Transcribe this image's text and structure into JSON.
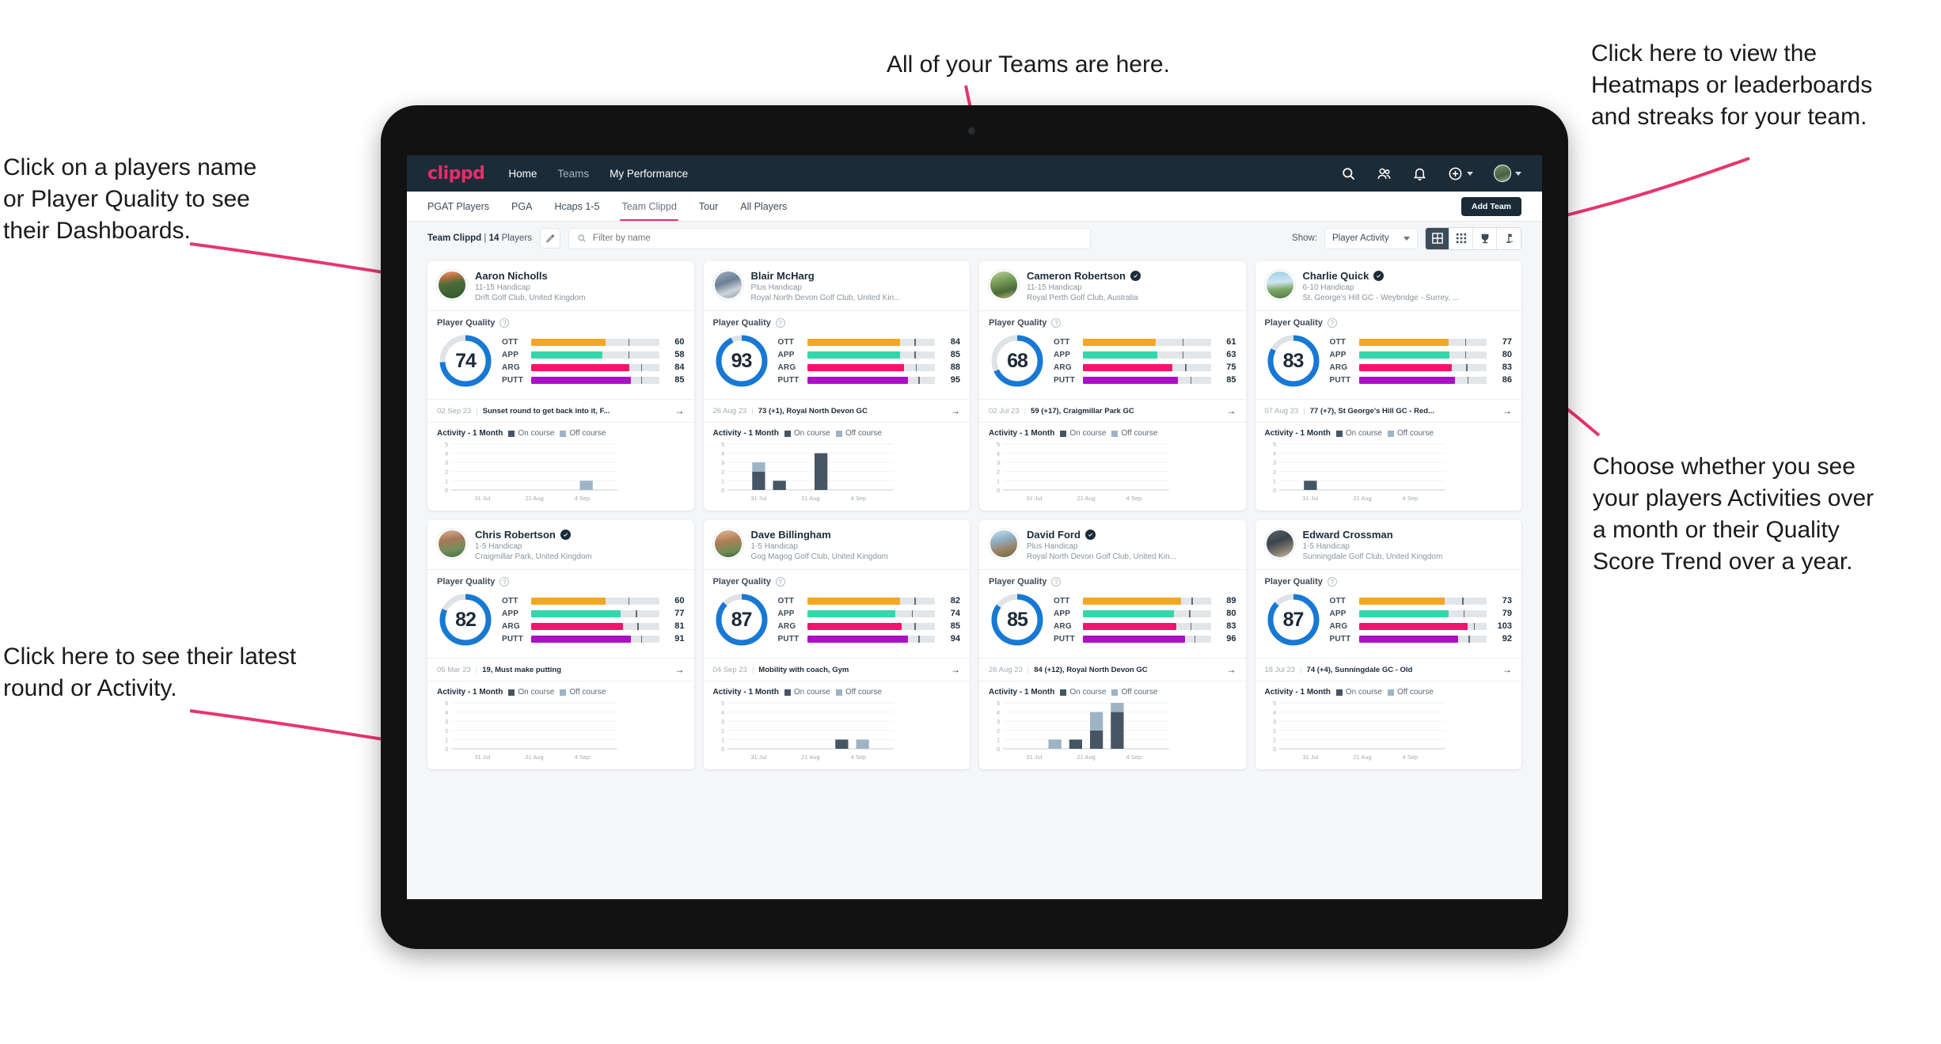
{
  "annotations": [
    {
      "id": "teams",
      "text": "All of your Teams are here."
    },
    {
      "id": "heatmaps",
      "text": "Click here to view the\nHeatmaps or leaderboards\nand streaks for your team."
    },
    {
      "id": "playername",
      "text": "Click on a players name\nor Player Quality to see\ntheir Dashboards."
    },
    {
      "id": "showmode",
      "text": "Choose whether you see\nyour players Activities over\na month or their Quality\nScore Trend over a year."
    },
    {
      "id": "latestround",
      "text": "Click here to see their latest\nround or Activity."
    }
  ],
  "app": {
    "logo": "clippd",
    "nav": [
      {
        "label": "Home",
        "active": true
      },
      {
        "label": "Teams",
        "active": false
      },
      {
        "label": "My Performance",
        "active": true
      }
    ],
    "icons": [
      "search-icon",
      "people-icon",
      "bell-icon",
      "plus-circle-icon",
      "avatar"
    ],
    "subtabs": [
      {
        "label": "PGAT Players",
        "active": false
      },
      {
        "label": "PGA",
        "active": false
      },
      {
        "label": "Hcaps 1-5",
        "active": false
      },
      {
        "label": "Team Clippd",
        "active": true
      },
      {
        "label": "Tour",
        "active": false
      },
      {
        "label": "All Players",
        "active": false
      }
    ],
    "add_team_label": "Add Team",
    "team_label_prefix": "Team Clippd",
    "team_label_sep": "|",
    "team_label_count": "14",
    "team_label_suffix": "Players",
    "search_placeholder": "Filter by name",
    "search_value": "",
    "show_label": "Show:",
    "show_value": "Player Activity",
    "show_options": [
      "Player Activity",
      "Quality Score Trend"
    ],
    "view_buttons": [
      "grid-view-icon",
      "dots-grid-icon",
      "trophy-icon",
      "flag-icon"
    ],
    "colors": {
      "brand_pink": "#ee2b6c",
      "navy": "#1c2b38",
      "ott": "#f5a623",
      "app": "#35d6ab",
      "arg": "#f5146b",
      "putt": "#aa11c4",
      "ring": "#1779d4",
      "on_course": "#455563",
      "off_course": "#9db4c6"
    }
  },
  "chart_data": {
    "type": "bar",
    "title": "Activity - 1 Month",
    "legend": [
      "On course",
      "Off course"
    ],
    "ylim": [
      0,
      5
    ],
    "yticks": [
      0,
      1,
      2,
      3,
      4,
      5
    ],
    "xticks": [
      "31 Jul",
      "21 Aug",
      "4 Sep"
    ],
    "series_names": [
      "On course",
      "Off course"
    ],
    "per_player": [
      {
        "player": "Aaron Nicholls",
        "bins": [
          {
            "i": 6,
            "on": 0,
            "off": 1
          }
        ]
      },
      {
        "player": "Blair McHarg",
        "bins": [
          {
            "i": 1,
            "on": 2,
            "off": 1
          },
          {
            "i": 2,
            "on": 1,
            "off": 0
          },
          {
            "i": 4,
            "on": 4,
            "off": 0
          }
        ]
      },
      {
        "player": "Cameron Robertson",
        "bins": []
      },
      {
        "player": "Charlie Quick",
        "bins": [
          {
            "i": 1,
            "on": 1,
            "off": 0
          }
        ]
      },
      {
        "player": "Chris Robertson",
        "bins": []
      },
      {
        "player": "Dave Billingham",
        "bins": [
          {
            "i": 5,
            "on": 1,
            "off": 0
          },
          {
            "i": 6,
            "on": 0,
            "off": 1
          }
        ]
      },
      {
        "player": "David Ford",
        "bins": [
          {
            "i": 2,
            "on": 0,
            "off": 1
          },
          {
            "i": 3,
            "on": 1,
            "off": 0
          },
          {
            "i": 4,
            "on": 2,
            "off": 2
          },
          {
            "i": 5,
            "on": 4,
            "off": 1
          }
        ]
      },
      {
        "player": "Edward Crossman",
        "bins": []
      }
    ]
  },
  "players": [
    {
      "name": "Aaron Nicholls",
      "verified": false,
      "handicap": "11-15 Handicap",
      "club": "Drift Golf Club, United Kingdom",
      "quality_label": "Player Quality",
      "score": 74,
      "metrics": [
        {
          "key": "OTT",
          "value": 60,
          "fill": 58,
          "tick": 76
        },
        {
          "key": "APP",
          "value": 58,
          "fill": 56,
          "tick": 76
        },
        {
          "key": "ARG",
          "value": 84,
          "fill": 77,
          "tick": 86
        },
        {
          "key": "PUTT",
          "value": 85,
          "fill": 78,
          "tick": 86
        }
      ],
      "round_date": "02 Sep 23",
      "round_text": "Sunset round to get back into it, F...",
      "activity_label": "Activity - 1 Month"
    },
    {
      "name": "Blair McHarg",
      "verified": false,
      "handicap": "Plus Handicap",
      "club": "Royal North Devon Golf Club, United Kin...",
      "quality_label": "Player Quality",
      "score": 93,
      "metrics": [
        {
          "key": "OTT",
          "value": 84,
          "fill": 73,
          "tick": 84
        },
        {
          "key": "APP",
          "value": 85,
          "fill": 73,
          "tick": 84
        },
        {
          "key": "ARG",
          "value": 88,
          "fill": 76,
          "tick": 85
        },
        {
          "key": "PUTT",
          "value": 95,
          "fill": 79,
          "tick": 87
        }
      ],
      "round_date": "26 Aug 23",
      "round_text": "73 (+1), Royal North Devon GC",
      "activity_label": "Activity - 1 Month"
    },
    {
      "name": "Cameron Robertson",
      "verified": true,
      "handicap": "11-15 Handicap",
      "club": "Royal Perth Golf Club, Australia",
      "quality_label": "Player Quality",
      "score": 68,
      "metrics": [
        {
          "key": "OTT",
          "value": 61,
          "fill": 57,
          "tick": 78
        },
        {
          "key": "APP",
          "value": 63,
          "fill": 58,
          "tick": 78
        },
        {
          "key": "ARG",
          "value": 75,
          "fill": 70,
          "tick": 80
        },
        {
          "key": "PUTT",
          "value": 85,
          "fill": 74,
          "tick": 84
        }
      ],
      "round_date": "02 Jul 23",
      "round_text": "59 (+17), Craigmillar Park GC",
      "activity_label": "Activity - 1 Month"
    },
    {
      "name": "Charlie Quick",
      "verified": true,
      "handicap": "6-10 Handicap",
      "club": "St. George's Hill GC - Weybridge - Surrey, ...",
      "quality_label": "Player Quality",
      "score": 83,
      "metrics": [
        {
          "key": "OTT",
          "value": 77,
          "fill": 70,
          "tick": 83
        },
        {
          "key": "APP",
          "value": 80,
          "fill": 71,
          "tick": 83
        },
        {
          "key": "ARG",
          "value": 83,
          "fill": 73,
          "tick": 84
        },
        {
          "key": "PUTT",
          "value": 86,
          "fill": 75,
          "tick": 85
        }
      ],
      "round_date": "07 Aug 23",
      "round_text": "77 (+7), St George's Hill GC - Red...",
      "activity_label": "Activity - 1 Month"
    },
    {
      "name": "Chris Robertson",
      "verified": true,
      "handicap": "1-5 Handicap",
      "club": "Craigmillar Park, United Kingdom",
      "quality_label": "Player Quality",
      "score": 82,
      "metrics": [
        {
          "key": "OTT",
          "value": 60,
          "fill": 58,
          "tick": 76
        },
        {
          "key": "APP",
          "value": 77,
          "fill": 70,
          "tick": 82
        },
        {
          "key": "ARG",
          "value": 81,
          "fill": 72,
          "tick": 83
        },
        {
          "key": "PUTT",
          "value": 91,
          "fill": 78,
          "tick": 86
        }
      ],
      "round_date": "05 Mar 23",
      "round_text": "19, Must make putting",
      "activity_label": "Activity - 1 Month"
    },
    {
      "name": "Dave Billingham",
      "verified": false,
      "handicap": "1-5 Handicap",
      "club": "Gog Magog Golf Club, United Kingdom",
      "quality_label": "Player Quality",
      "score": 87,
      "metrics": [
        {
          "key": "OTT",
          "value": 82,
          "fill": 73,
          "tick": 84
        },
        {
          "key": "APP",
          "value": 74,
          "fill": 69,
          "tick": 82
        },
        {
          "key": "ARG",
          "value": 85,
          "fill": 74,
          "tick": 84
        },
        {
          "key": "PUTT",
          "value": 94,
          "fill": 79,
          "tick": 87
        }
      ],
      "round_date": "04 Sep 23",
      "round_text": "Mobility with coach, Gym",
      "activity_label": "Activity - 1 Month"
    },
    {
      "name": "David Ford",
      "verified": true,
      "handicap": "Plus Handicap",
      "club": "Royal North Devon Golf Club, United Kin...",
      "quality_label": "Player Quality",
      "score": 85,
      "metrics": [
        {
          "key": "OTT",
          "value": 89,
          "fill": 77,
          "tick": 85
        },
        {
          "key": "APP",
          "value": 80,
          "fill": 71,
          "tick": 83
        },
        {
          "key": "ARG",
          "value": 83,
          "fill": 73,
          "tick": 84
        },
        {
          "key": "PUTT",
          "value": 96,
          "fill": 80,
          "tick": 87
        }
      ],
      "round_date": "26 Aug 23",
      "round_text": "84 (+12), Royal North Devon GC",
      "activity_label": "Activity - 1 Month"
    },
    {
      "name": "Edward Crossman",
      "verified": false,
      "handicap": "1-5 Handicap",
      "club": "Sunningdale Golf Club, United Kingdom",
      "quality_label": "Player Quality",
      "score": 87,
      "metrics": [
        {
          "key": "OTT",
          "value": 73,
          "fill": 67,
          "tick": 81
        },
        {
          "key": "APP",
          "value": 79,
          "fill": 70,
          "tick": 82
        },
        {
          "key": "ARG",
          "value": 103,
          "fill": 85,
          "tick": 90
        },
        {
          "key": "PUTT",
          "value": 92,
          "fill": 78,
          "tick": 86
        }
      ],
      "round_date": "18 Jul 23",
      "round_text": "74 (+4), Sunningdale GC - Old",
      "activity_label": "Activity - 1 Month"
    }
  ]
}
